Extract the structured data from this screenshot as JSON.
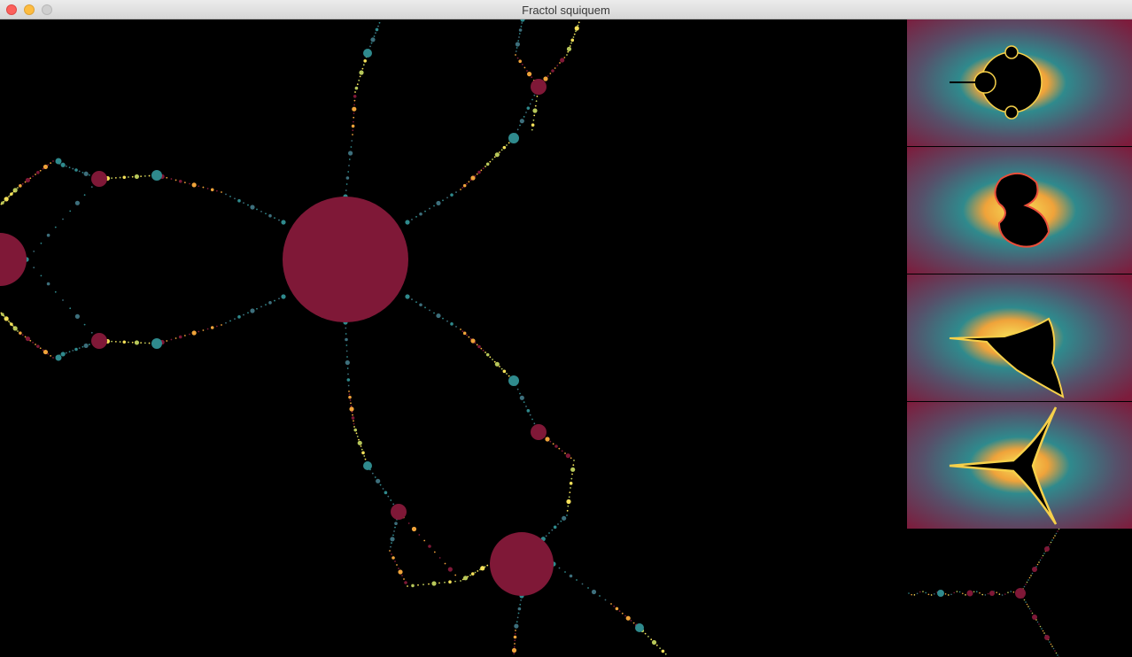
{
  "window": {
    "title": "Fractol squiquem"
  },
  "palette": {
    "background": "#000000",
    "set_fill": "#7f1837",
    "teal": "#2f8a8d",
    "orange": "#f0a33a",
    "yellow": "#f6e15a",
    "thumb_outer": "#7d1c3c"
  },
  "thumbnails": [
    {
      "name": "mandelbrot"
    },
    {
      "name": "julia"
    },
    {
      "name": "burning-ship"
    },
    {
      "name": "tricorn"
    }
  ]
}
